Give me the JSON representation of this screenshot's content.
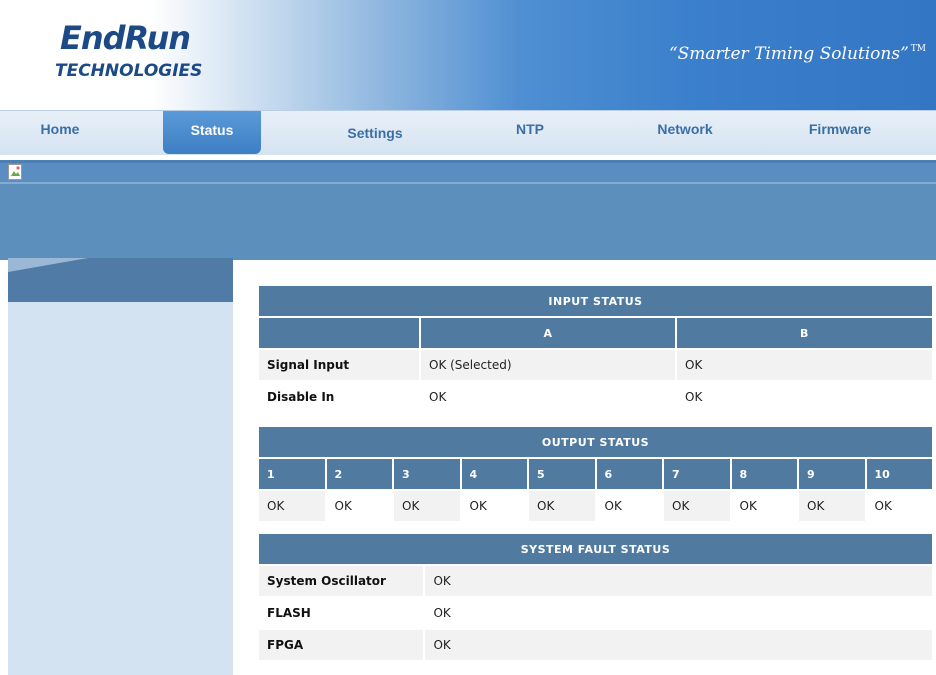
{
  "header": {
    "logo_main": "EndRun",
    "logo_sub": "TECHNOLOGIES",
    "tagline": "“Smarter Timing Solutions”",
    "tagline_tm": "TM"
  },
  "nav": {
    "items": [
      {
        "label": "Home"
      },
      {
        "label": "Status"
      },
      {
        "label": "Settings"
      },
      {
        "label": "NTP"
      },
      {
        "label": "Network"
      },
      {
        "label": "Firmware"
      }
    ],
    "active": "Status"
  },
  "input_status": {
    "title": "INPUT STATUS",
    "columns": [
      "",
      "A",
      "B"
    ],
    "rows": [
      {
        "label": "Signal Input",
        "a": "OK (Selected)",
        "b": "OK"
      },
      {
        "label": "Disable In",
        "a": "OK",
        "b": "OK"
      }
    ]
  },
  "output_status": {
    "title": "OUTPUT STATUS",
    "channels": [
      "1",
      "2",
      "3",
      "4",
      "5",
      "6",
      "7",
      "8",
      "9",
      "10"
    ],
    "values": [
      "OK",
      "OK",
      "OK",
      "OK",
      "OK",
      "OK",
      "OK",
      "OK",
      "OK",
      "OK"
    ]
  },
  "system_fault_status": {
    "title": "SYSTEM FAULT STATUS",
    "rows": [
      {
        "label": "System Oscillator",
        "value": "OK"
      },
      {
        "label": "FLASH",
        "value": "OK"
      },
      {
        "label": "FPGA",
        "value": "OK"
      }
    ]
  },
  "colors": {
    "header_blue": "#517aa1",
    "nav_active": "#3d7fc4",
    "sidebar": "#d4e3f2",
    "band": "#5d8fbd"
  }
}
